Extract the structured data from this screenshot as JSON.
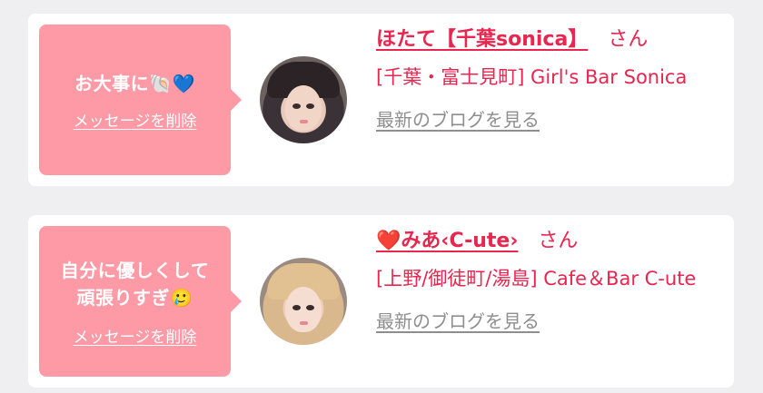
{
  "messages": [
    {
      "text": "お大事に🐚💙",
      "delete_label": "メッセージを削除",
      "name": "ほたて【千葉sonica】",
      "honorific": "さん",
      "shop": "[千葉・富士見町] Girl's Bar Sonica",
      "blog_link": "最新のブログを見る"
    },
    {
      "text": "自分に優しくして\n頑張りすぎ🥲",
      "delete_label": "メッセージを削除",
      "name": "❤️みあ‹C-ute›",
      "honorific": "さん",
      "shop": "[上野/御徒町/湯島] Cafe＆Bar C-ute",
      "blog_link": "最新のブログを見る"
    }
  ],
  "colors": {
    "bubble": "#fd9aa6",
    "accent": "#e8264f",
    "link_gray": "#8e8e8e",
    "background": "#efeff1"
  }
}
